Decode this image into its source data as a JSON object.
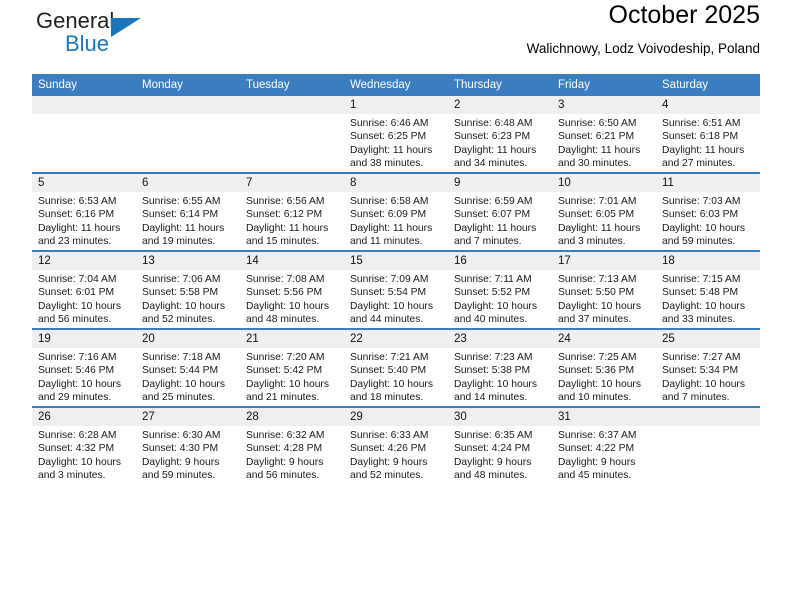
{
  "brand": {
    "name_part1": "General",
    "name_part2": "Blue",
    "accent_color": "#1b75bb",
    "triangle_icon": "brand-triangle-icon"
  },
  "header": {
    "title": "October 2025",
    "subtitle": "Walichnowy, Lodz Voivodeship, Poland"
  },
  "theme": {
    "header_row_color": "#3a7ebf",
    "daynum_band_color": "#efefef",
    "text_color": "#1a1a1a"
  },
  "weekdays": [
    "Sunday",
    "Monday",
    "Tuesday",
    "Wednesday",
    "Thursday",
    "Friday",
    "Saturday"
  ],
  "weeks": [
    [
      {
        "day": "",
        "lines": []
      },
      {
        "day": "",
        "lines": []
      },
      {
        "day": "",
        "lines": []
      },
      {
        "day": "1",
        "lines": [
          "Sunrise: 6:46 AM",
          "Sunset: 6:25 PM",
          "Daylight: 11 hours",
          "and 38 minutes."
        ]
      },
      {
        "day": "2",
        "lines": [
          "Sunrise: 6:48 AM",
          "Sunset: 6:23 PM",
          "Daylight: 11 hours",
          "and 34 minutes."
        ]
      },
      {
        "day": "3",
        "lines": [
          "Sunrise: 6:50 AM",
          "Sunset: 6:21 PM",
          "Daylight: 11 hours",
          "and 30 minutes."
        ]
      },
      {
        "day": "4",
        "lines": [
          "Sunrise: 6:51 AM",
          "Sunset: 6:18 PM",
          "Daylight: 11 hours",
          "and 27 minutes."
        ]
      }
    ],
    [
      {
        "day": "5",
        "lines": [
          "Sunrise: 6:53 AM",
          "Sunset: 6:16 PM",
          "Daylight: 11 hours",
          "and 23 minutes."
        ]
      },
      {
        "day": "6",
        "lines": [
          "Sunrise: 6:55 AM",
          "Sunset: 6:14 PM",
          "Daylight: 11 hours",
          "and 19 minutes."
        ]
      },
      {
        "day": "7",
        "lines": [
          "Sunrise: 6:56 AM",
          "Sunset: 6:12 PM",
          "Daylight: 11 hours",
          "and 15 minutes."
        ]
      },
      {
        "day": "8",
        "lines": [
          "Sunrise: 6:58 AM",
          "Sunset: 6:09 PM",
          "Daylight: 11 hours",
          "and 11 minutes."
        ]
      },
      {
        "day": "9",
        "lines": [
          "Sunrise: 6:59 AM",
          "Sunset: 6:07 PM",
          "Daylight: 11 hours",
          "and 7 minutes."
        ]
      },
      {
        "day": "10",
        "lines": [
          "Sunrise: 7:01 AM",
          "Sunset: 6:05 PM",
          "Daylight: 11 hours",
          "and 3 minutes."
        ]
      },
      {
        "day": "11",
        "lines": [
          "Sunrise: 7:03 AM",
          "Sunset: 6:03 PM",
          "Daylight: 10 hours",
          "and 59 minutes."
        ]
      }
    ],
    [
      {
        "day": "12",
        "lines": [
          "Sunrise: 7:04 AM",
          "Sunset: 6:01 PM",
          "Daylight: 10 hours",
          "and 56 minutes."
        ]
      },
      {
        "day": "13",
        "lines": [
          "Sunrise: 7:06 AM",
          "Sunset: 5:58 PM",
          "Daylight: 10 hours",
          "and 52 minutes."
        ]
      },
      {
        "day": "14",
        "lines": [
          "Sunrise: 7:08 AM",
          "Sunset: 5:56 PM",
          "Daylight: 10 hours",
          "and 48 minutes."
        ]
      },
      {
        "day": "15",
        "lines": [
          "Sunrise: 7:09 AM",
          "Sunset: 5:54 PM",
          "Daylight: 10 hours",
          "and 44 minutes."
        ]
      },
      {
        "day": "16",
        "lines": [
          "Sunrise: 7:11 AM",
          "Sunset: 5:52 PM",
          "Daylight: 10 hours",
          "and 40 minutes."
        ]
      },
      {
        "day": "17",
        "lines": [
          "Sunrise: 7:13 AM",
          "Sunset: 5:50 PM",
          "Daylight: 10 hours",
          "and 37 minutes."
        ]
      },
      {
        "day": "18",
        "lines": [
          "Sunrise: 7:15 AM",
          "Sunset: 5:48 PM",
          "Daylight: 10 hours",
          "and 33 minutes."
        ]
      }
    ],
    [
      {
        "day": "19",
        "lines": [
          "Sunrise: 7:16 AM",
          "Sunset: 5:46 PM",
          "Daylight: 10 hours",
          "and 29 minutes."
        ]
      },
      {
        "day": "20",
        "lines": [
          "Sunrise: 7:18 AM",
          "Sunset: 5:44 PM",
          "Daylight: 10 hours",
          "and 25 minutes."
        ]
      },
      {
        "day": "21",
        "lines": [
          "Sunrise: 7:20 AM",
          "Sunset: 5:42 PM",
          "Daylight: 10 hours",
          "and 21 minutes."
        ]
      },
      {
        "day": "22",
        "lines": [
          "Sunrise: 7:21 AM",
          "Sunset: 5:40 PM",
          "Daylight: 10 hours",
          "and 18 minutes."
        ]
      },
      {
        "day": "23",
        "lines": [
          "Sunrise: 7:23 AM",
          "Sunset: 5:38 PM",
          "Daylight: 10 hours",
          "and 14 minutes."
        ]
      },
      {
        "day": "24",
        "lines": [
          "Sunrise: 7:25 AM",
          "Sunset: 5:36 PM",
          "Daylight: 10 hours",
          "and 10 minutes."
        ]
      },
      {
        "day": "25",
        "lines": [
          "Sunrise: 7:27 AM",
          "Sunset: 5:34 PM",
          "Daylight: 10 hours",
          "and 7 minutes."
        ]
      }
    ],
    [
      {
        "day": "26",
        "lines": [
          "Sunrise: 6:28 AM",
          "Sunset: 4:32 PM",
          "Daylight: 10 hours",
          "and 3 minutes."
        ]
      },
      {
        "day": "27",
        "lines": [
          "Sunrise: 6:30 AM",
          "Sunset: 4:30 PM",
          "Daylight: 9 hours",
          "and 59 minutes."
        ]
      },
      {
        "day": "28",
        "lines": [
          "Sunrise: 6:32 AM",
          "Sunset: 4:28 PM",
          "Daylight: 9 hours",
          "and 56 minutes."
        ]
      },
      {
        "day": "29",
        "lines": [
          "Sunrise: 6:33 AM",
          "Sunset: 4:26 PM",
          "Daylight: 9 hours",
          "and 52 minutes."
        ]
      },
      {
        "day": "30",
        "lines": [
          "Sunrise: 6:35 AM",
          "Sunset: 4:24 PM",
          "Daylight: 9 hours",
          "and 48 minutes."
        ]
      },
      {
        "day": "31",
        "lines": [
          "Sunrise: 6:37 AM",
          "Sunset: 4:22 PM",
          "Daylight: 9 hours",
          "and 45 minutes."
        ]
      },
      {
        "day": "",
        "lines": []
      }
    ]
  ]
}
